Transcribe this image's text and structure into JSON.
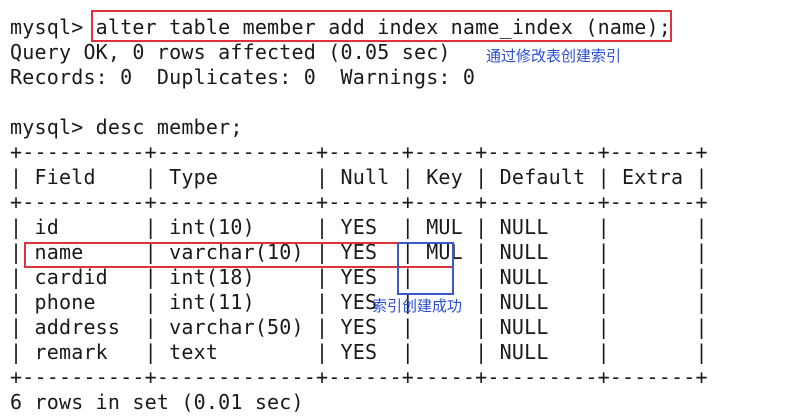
{
  "terminal": {
    "lines": [
      "mysql> alter table member add index name_index (name);",
      "Query OK, 0 rows affected (0.05 sec)",
      "Records: 0  Duplicates: 0  Warnings: 0",
      "",
      "mysql> desc member;",
      "+----------+-------------+------+-----+---------+-------+",
      "| Field    | Type        | Null | Key | Default | Extra |",
      "+----------+-------------+------+-----+---------+-------+",
      "| id       | int(10)     | YES  | MUL | NULL    |       |",
      "| name     | varchar(10) | YES  | MUL | NULL    |       |",
      "| cardid   | int(18)     | YES  |     | NULL    |       |",
      "| phone    | int(11)     | YES  |     | NULL    |       |",
      "| address  | varchar(50) | YES  |     | NULL    |       |",
      "| remark   | text        | YES  |     | NULL    |       |",
      "+----------+-------------+------+-----+---------+-------+",
      "6 rows in set (0.01 sec)"
    ]
  },
  "annotations": {
    "alter_note": "通过修改表创建索引",
    "success_note": "索引创建成功"
  },
  "colors": {
    "text": "#1a1a1a",
    "highlight_red": "#e0313f",
    "highlight_blue": "#3d58c8",
    "note_blue": "#2a4fd0",
    "background": "#ffffff"
  }
}
